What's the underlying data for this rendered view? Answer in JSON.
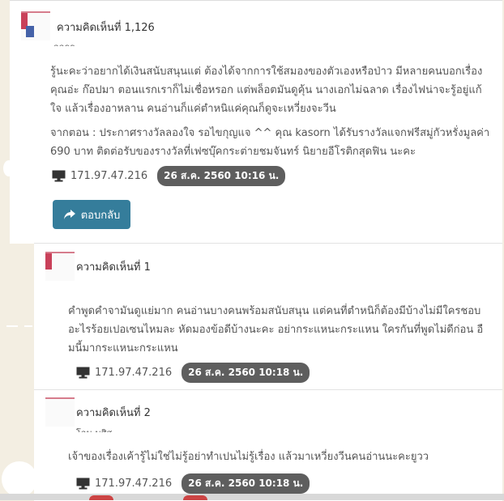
{
  "main_comment": {
    "title": "ความคิดเห็นที่ 1,126",
    "user": "ลลธร",
    "body_p1": "รู้นะคะว่าอยากได้เงินสนับสนุนแต่ ต้องได้จากการใช้สมองของตัวเองหรือป่าว มีหลายคนบอกเรื่องคุณอ่ะ ก๊อปมา ตอนแรกเราก็ไม่เชื่อหรอก แต่พล็อตมันดูคุ้น นางเอกไม่ฉลาด เรื่องไฟน่าจะรู้อยู่แก้ใจ แล้วเรื่องอาหลาน คนอ่านก็แค่ตำหนิแค่คุณก็ดูจะเหวี่ยงจะวีน",
    "body_p2": "จากตอน : ประกาศรางวัลลองใจ รอไขกุญแจ ^^ คุณ kasorn ได้รับรางวัลแจกฟรีสมู่กัวหรั่งมูลค่า 690 บาท ติดต่อรับของรางวัลที่เฟซบุ๊คกระต่ายชมจันทร์ นิยายอีโรติกสุดฟิน นะคะ",
    "ip": "171.97.47.216",
    "date": "26 ส.ค. 2560 10:16 น.",
    "reply_label": "ตอบกลับ"
  },
  "replies": [
    {
      "title": "ความคิดเห็นที่ 1",
      "user": "",
      "body": "คำพูดคำจามันดูแย่มาก คนอ่านบางคนพร้อมสนับสนุน แต่คนที่ตำหนิก็ต้องมีบ้างไม่มีใครชอบอะไรร้อยเปอเซนไหมละ หัดมองข้อดีบ้างนะคะ อย่ากระแหนะกระแหน ใครกันที่พูดไม่ดีก่อน อืมนี้มากระแหนะกระแหน",
      "ip": "171.97.47.216",
      "date": "26 ส.ค. 2560 10:18 น."
    },
    {
      "title": "ความคิดเห็นที่ 2",
      "user": "โอน บศิส",
      "body": "เจ้าของเรื่องเค้ารู้ไม่ใช่ไม่รู้อย่าทำเปนไม่รู้เรื่อง แล้วมาเหวี่ยงวีนคนอ่านนะคะยูวว",
      "ip": "171.97.47.216",
      "date": "26 ส.ค. 2560 10:18 น."
    }
  ]
}
